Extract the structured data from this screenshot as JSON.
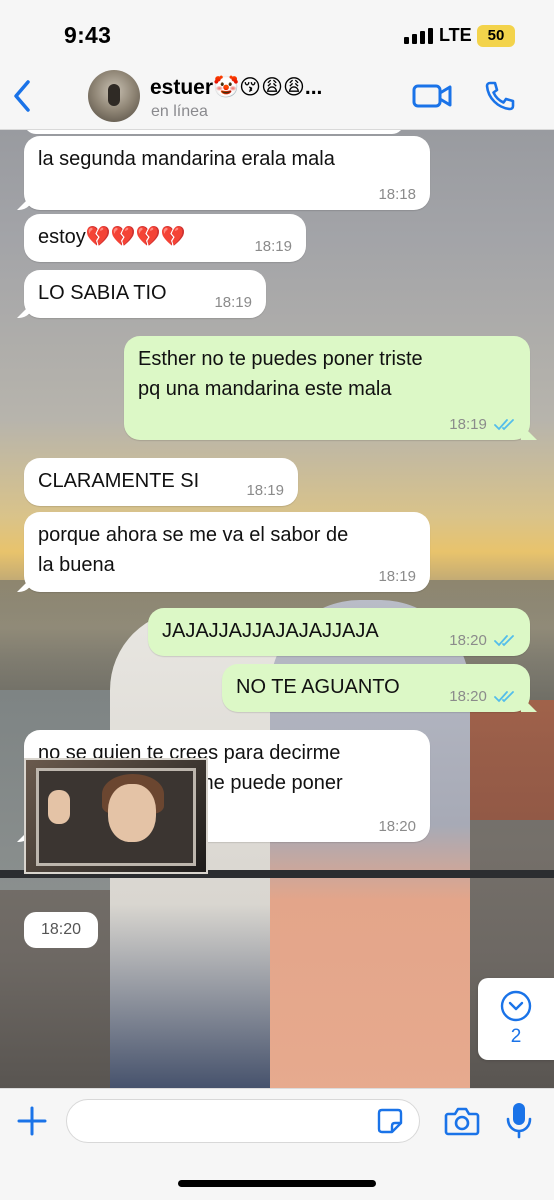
{
  "status_bar": {
    "time": "9:43",
    "network": "LTE",
    "battery": "50"
  },
  "header": {
    "contact_name": "estuer🤡😚😩😩...",
    "contact_status": "en línea"
  },
  "messages": [
    {
      "direction": "in",
      "text": "la segunda mandarina erala mala",
      "time": "18:18"
    },
    {
      "direction": "in",
      "text": "estoy💔💔💔💔",
      "time": "18:19"
    },
    {
      "direction": "in",
      "text": "LO SABIA TIO",
      "time": "18:19"
    },
    {
      "direction": "out",
      "text": "Esther no te puedes poner triste\npq una mandarina este mala",
      "time": "18:19",
      "read": true
    },
    {
      "direction": "in",
      "text": "CLARAMENTE SI",
      "time": "18:19"
    },
    {
      "direction": "in",
      "text": "porque ahora se me va el sabor de\nla buena",
      "time": "18:19"
    },
    {
      "direction": "out",
      "text": "JAJAJJAJJAJAJAJJAJA",
      "time": "18:20",
      "read": true
    },
    {
      "direction": "out",
      "text": "NO TE AGUANTO",
      "time": "18:20",
      "read": true
    },
    {
      "direction": "in",
      "text": "no se quien te crees para decirme\nsi una mandarina me puede poner\ntriste o no",
      "time": "18:20"
    }
  ],
  "sticker": {
    "time": "18:20"
  },
  "scroll_down": {
    "unread_count": "2"
  },
  "composer": {
    "placeholder": ""
  },
  "colors": {
    "accent": "#1a73e8",
    "outgoing_bubble": "#dcf8c6",
    "incoming_bubble": "#ffffff",
    "read_ticks": "#53bdeb"
  }
}
